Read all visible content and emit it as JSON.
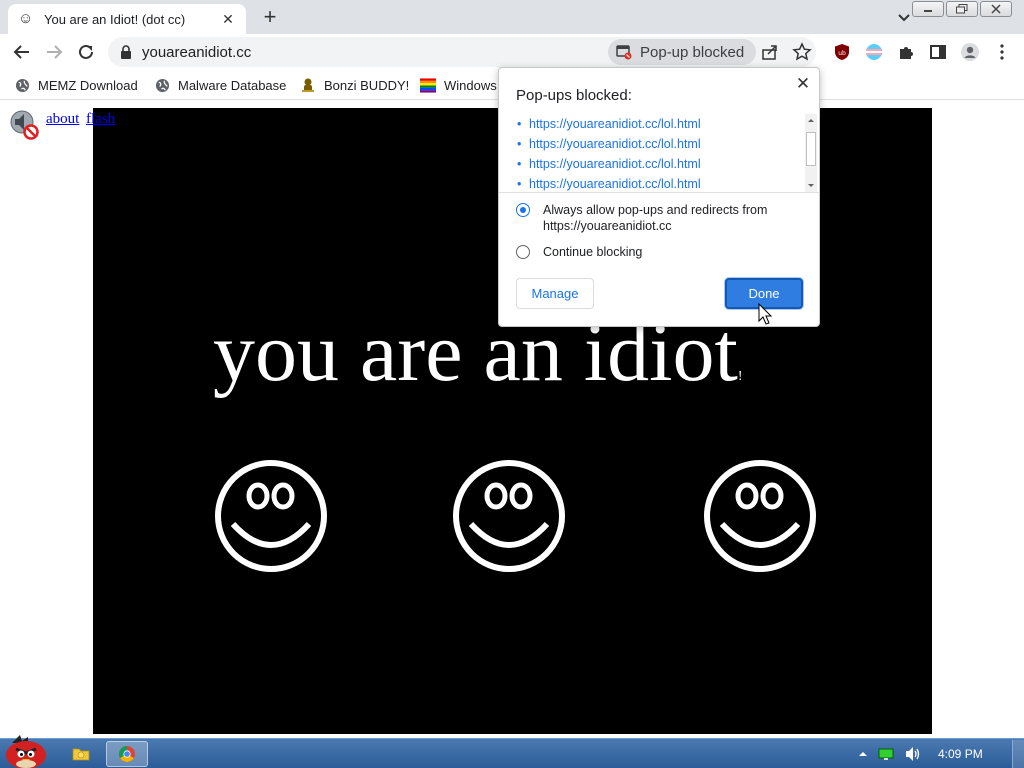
{
  "window": {
    "tab_title": "You are an Idiot! (dot cc)"
  },
  "toolbar": {
    "url": "youareanidiot.cc",
    "popup_chip_label": "Pop-up blocked"
  },
  "bookmarks": [
    {
      "label": "MEMZ Download",
      "icon": "globe-icon"
    },
    {
      "label": "Malware Database",
      "icon": "globe-icon"
    },
    {
      "label": "Bonzi BUDDY!",
      "icon": "bonzi-icon"
    },
    {
      "label": "Windows",
      "icon": "windows-flag-icon"
    }
  ],
  "page": {
    "links": [
      "about",
      "flash"
    ],
    "headline": "you are an idiot",
    "headline_suffix": "!"
  },
  "dialog": {
    "title": "Pop-ups blocked:",
    "blocked_urls": [
      "https://youareanidiot.cc/lol.html",
      "https://youareanidiot.cc/lol.html",
      "https://youareanidiot.cc/lol.html",
      "https://youareanidiot.cc/lol.html"
    ],
    "option_allow_line1": "Always allow pop-ups and redirects from",
    "option_allow_line2": "https://youareanidiot.cc",
    "option_block": "Continue blocking",
    "manage_label": "Manage",
    "done_label": "Done",
    "selected_option": "allow"
  },
  "taskbar": {
    "clock": "4:09 PM"
  },
  "colors": {
    "link_blue": "#1a73e8",
    "stage_black": "#000000",
    "done_button": "#2f7de1"
  }
}
